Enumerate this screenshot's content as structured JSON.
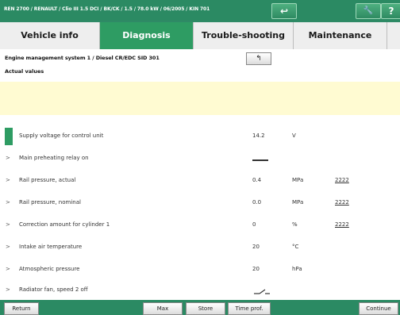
{
  "window": {
    "title": "REN 2700 / RENAULT / Clio III 1.5 DCI / BK/CK / 1.5 / 78.0 kW / 06/2005 / KIN 701"
  },
  "title_buttons": {
    "back_glyph": "↩",
    "tools_glyph": "🔧",
    "help_glyph": "?"
  },
  "tabs": [
    {
      "label": "Vehicle info",
      "active": false
    },
    {
      "label": "Diagnosis",
      "active": true
    },
    {
      "label": "Trouble-shooting",
      "active": false
    },
    {
      "label": "Maintenance",
      "active": false
    }
  ],
  "main": {
    "system_title": "Engine management system 1 / Diesel CR/EDC SID 301",
    "subtitle": "Actual values",
    "back_button": "↰"
  },
  "rows": [
    {
      "label": "Supply voltage for control unit",
      "value": "14.2",
      "unit": "V",
      "extra": "",
      "selected": true
    },
    {
      "label": "Main preheating relay on",
      "value": "",
      "unit": "",
      "extra": "",
      "icon": "line"
    },
    {
      "label": "Rail pressure, actual",
      "value": "0.4",
      "unit": "MPa",
      "extra": "2222"
    },
    {
      "label": "Rail pressure, nominal",
      "value": "0.0",
      "unit": "MPa",
      "extra": "2222"
    },
    {
      "label": "Correction amount for cylinder 1",
      "value": "0",
      "unit": "%",
      "extra": "2222"
    },
    {
      "label": "Intake air temperature",
      "value": "20",
      "unit": "°C",
      "extra": ""
    },
    {
      "label": "Atmospheric pressure",
      "value": "20",
      "unit": "hPa",
      "extra": ""
    },
    {
      "label": "Radiator fan, speed 2 off",
      "value": "",
      "unit": "",
      "extra": "",
      "icon": "switch"
    }
  ],
  "bottom": {
    "return": "Return",
    "max": "Max",
    "store": "Store",
    "time_prof": "Time prof.",
    "continue": "Continue"
  }
}
